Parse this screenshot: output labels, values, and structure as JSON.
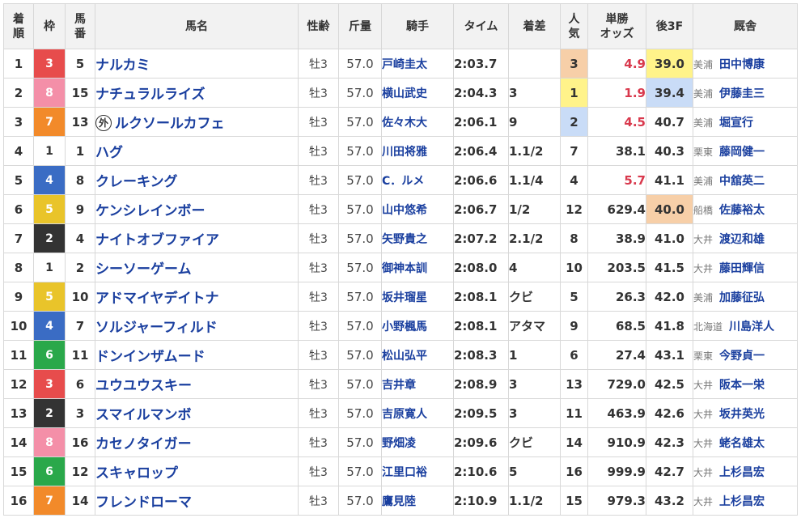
{
  "table": {
    "headers": {
      "rank": [
        "着",
        "順"
      ],
      "waku": "枠",
      "umaban": [
        "馬",
        "番"
      ],
      "name": "馬名",
      "sexage": "性齢",
      "weight": "斤量",
      "jockey": "騎手",
      "time": "タイム",
      "margin": "着差",
      "pop": [
        "人",
        "気"
      ],
      "odds": [
        "単勝",
        "オッズ"
      ],
      "last3f": "後3F",
      "trainer": "厩舎"
    },
    "waku_colors": {
      "1": {
        "bg": "#ffffff",
        "fg": "#333333"
      },
      "2": {
        "bg": "#333333",
        "fg": "#ffffff"
      },
      "3": {
        "bg": "#e74c4c",
        "fg": "#ffffff"
      },
      "4": {
        "bg": "#3a6cc4",
        "fg": "#ffffff"
      },
      "5": {
        "bg": "#e9c42a",
        "fg": "#ffffff"
      },
      "6": {
        "bg": "#2aa84a",
        "fg": "#ffffff"
      },
      "7": {
        "bg": "#f28a2a",
        "fg": "#ffffff"
      },
      "8": {
        "bg": "#f48fa8",
        "fg": "#ffffff"
      }
    },
    "highlight_colors": {
      "orange": "#f7cfa8",
      "yellow": "#fff38a",
      "blue": "#c9dcf7",
      "odds_red": "#d9394d"
    },
    "rows": [
      {
        "rank": "1",
        "waku": "3",
        "umaban": "5",
        "name": "ナルカミ",
        "foreign": "",
        "sexage": "牡3",
        "weight": "57.0",
        "jockey": "戸崎圭太",
        "time": "2:03.7",
        "margin": "",
        "pop": "3",
        "pop_hl": "orange",
        "odds": "4.9",
        "odds_red": true,
        "last3f": "39.0",
        "last3f_hl": "yellow",
        "area": "美浦",
        "trainer": "田中博康"
      },
      {
        "rank": "2",
        "waku": "8",
        "umaban": "15",
        "name": "ナチュラルライズ",
        "foreign": "",
        "sexage": "牡3",
        "weight": "57.0",
        "jockey": "横山武史",
        "time": "2:04.3",
        "margin": "3",
        "pop": "1",
        "pop_hl": "yellow",
        "odds": "1.9",
        "odds_red": true,
        "last3f": "39.4",
        "last3f_hl": "blue",
        "area": "美浦",
        "trainer": "伊藤圭三"
      },
      {
        "rank": "3",
        "waku": "7",
        "umaban": "13",
        "name": "ルクソールカフェ",
        "foreign": "外",
        "sexage": "牡3",
        "weight": "57.0",
        "jockey": "佐々木大",
        "time": "2:06.1",
        "margin": "9",
        "pop": "2",
        "pop_hl": "blue",
        "odds": "4.5",
        "odds_red": true,
        "last3f": "40.7",
        "last3f_hl": "",
        "area": "美浦",
        "trainer": "堀宣行"
      },
      {
        "rank": "4",
        "waku": "1",
        "umaban": "1",
        "name": "ハグ",
        "foreign": "",
        "sexage": "牡3",
        "weight": "57.0",
        "jockey": "川田将雅",
        "time": "2:06.4",
        "margin": "1.1/2",
        "pop": "7",
        "pop_hl": "",
        "odds": "38.1",
        "odds_red": false,
        "last3f": "40.3",
        "last3f_hl": "",
        "area": "栗東",
        "trainer": "藤岡健一"
      },
      {
        "rank": "5",
        "waku": "4",
        "umaban": "8",
        "name": "クレーキング",
        "foreign": "",
        "sexage": "牡3",
        "weight": "57.0",
        "jockey": "C．ルメ",
        "time": "2:06.6",
        "margin": "1.1/4",
        "pop": "4",
        "pop_hl": "",
        "odds": "5.7",
        "odds_red": true,
        "last3f": "41.1",
        "last3f_hl": "",
        "area": "美浦",
        "trainer": "中舘英二"
      },
      {
        "rank": "6",
        "waku": "5",
        "umaban": "9",
        "name": "ケンシレインボー",
        "foreign": "",
        "sexage": "牡3",
        "weight": "57.0",
        "jockey": "山中悠希",
        "time": "2:06.7",
        "margin": "1/2",
        "pop": "12",
        "pop_hl": "",
        "odds": "629.4",
        "odds_red": false,
        "last3f": "40.0",
        "last3f_hl": "orange",
        "area": "船橋",
        "trainer": "佐藤裕太"
      },
      {
        "rank": "7",
        "waku": "2",
        "umaban": "4",
        "name": "ナイトオブファイア",
        "foreign": "",
        "sexage": "牡3",
        "weight": "57.0",
        "jockey": "矢野貴之",
        "time": "2:07.2",
        "margin": "2.1/2",
        "pop": "8",
        "pop_hl": "",
        "odds": "38.9",
        "odds_red": false,
        "last3f": "41.0",
        "last3f_hl": "",
        "area": "大井",
        "trainer": "渡辺和雄"
      },
      {
        "rank": "8",
        "waku": "1",
        "umaban": "2",
        "name": "シーソーゲーム",
        "foreign": "",
        "sexage": "牡3",
        "weight": "57.0",
        "jockey": "御神本訓",
        "time": "2:08.0",
        "margin": "4",
        "pop": "10",
        "pop_hl": "",
        "odds": "203.5",
        "odds_red": false,
        "last3f": "41.5",
        "last3f_hl": "",
        "area": "大井",
        "trainer": "藤田輝信"
      },
      {
        "rank": "9",
        "waku": "5",
        "umaban": "10",
        "name": "アドマイヤデイトナ",
        "foreign": "",
        "sexage": "牡3",
        "weight": "57.0",
        "jockey": "坂井瑠星",
        "time": "2:08.1",
        "margin": "クビ",
        "pop": "5",
        "pop_hl": "",
        "odds": "26.3",
        "odds_red": false,
        "last3f": "42.0",
        "last3f_hl": "",
        "area": "美浦",
        "trainer": "加藤征弘"
      },
      {
        "rank": "10",
        "waku": "4",
        "umaban": "7",
        "name": "ソルジャーフィルド",
        "foreign": "",
        "sexage": "牡3",
        "weight": "57.0",
        "jockey": "小野楓馬",
        "time": "2:08.1",
        "margin": "アタマ",
        "pop": "9",
        "pop_hl": "",
        "odds": "68.5",
        "odds_red": false,
        "last3f": "41.8",
        "last3f_hl": "",
        "area": "北海道",
        "trainer": "川島洋人"
      },
      {
        "rank": "11",
        "waku": "6",
        "umaban": "11",
        "name": "ドンインザムード",
        "foreign": "",
        "sexage": "牡3",
        "weight": "57.0",
        "jockey": "松山弘平",
        "time": "2:08.3",
        "margin": "1",
        "pop": "6",
        "pop_hl": "",
        "odds": "27.4",
        "odds_red": false,
        "last3f": "43.1",
        "last3f_hl": "",
        "area": "栗東",
        "trainer": "今野貞一"
      },
      {
        "rank": "12",
        "waku": "3",
        "umaban": "6",
        "name": "ユウユウスキー",
        "foreign": "",
        "sexage": "牡3",
        "weight": "57.0",
        "jockey": "吉井章",
        "time": "2:08.9",
        "margin": "3",
        "pop": "13",
        "pop_hl": "",
        "odds": "729.0",
        "odds_red": false,
        "last3f": "42.5",
        "last3f_hl": "",
        "area": "大井",
        "trainer": "阪本一栄"
      },
      {
        "rank": "13",
        "waku": "2",
        "umaban": "3",
        "name": "スマイルマンボ",
        "foreign": "",
        "sexage": "牡3",
        "weight": "57.0",
        "jockey": "吉原寛人",
        "time": "2:09.5",
        "margin": "3",
        "pop": "11",
        "pop_hl": "",
        "odds": "463.9",
        "odds_red": false,
        "last3f": "42.6",
        "last3f_hl": "",
        "area": "大井",
        "trainer": "坂井英光"
      },
      {
        "rank": "14",
        "waku": "8",
        "umaban": "16",
        "name": "カセノタイガー",
        "foreign": "",
        "sexage": "牡3",
        "weight": "57.0",
        "jockey": "野畑凌",
        "time": "2:09.6",
        "margin": "クビ",
        "pop": "14",
        "pop_hl": "",
        "odds": "910.9",
        "odds_red": false,
        "last3f": "42.3",
        "last3f_hl": "",
        "area": "大井",
        "trainer": "蛯名雄太"
      },
      {
        "rank": "15",
        "waku": "6",
        "umaban": "12",
        "name": "スキャロップ",
        "foreign": "",
        "sexage": "牡3",
        "weight": "57.0",
        "jockey": "江里口裕",
        "time": "2:10.6",
        "margin": "5",
        "pop": "16",
        "pop_hl": "",
        "odds": "999.9",
        "odds_red": false,
        "last3f": "42.7",
        "last3f_hl": "",
        "area": "大井",
        "trainer": "上杉昌宏"
      },
      {
        "rank": "16",
        "waku": "7",
        "umaban": "14",
        "name": "フレンドローマ",
        "foreign": "",
        "sexage": "牡3",
        "weight": "57.0",
        "jockey": "鷹見陸",
        "time": "2:10.9",
        "margin": "1.1/2",
        "pop": "15",
        "pop_hl": "",
        "odds": "979.3",
        "odds_red": false,
        "last3f": "43.2",
        "last3f_hl": "",
        "area": "大井",
        "trainer": "上杉昌宏"
      }
    ]
  }
}
